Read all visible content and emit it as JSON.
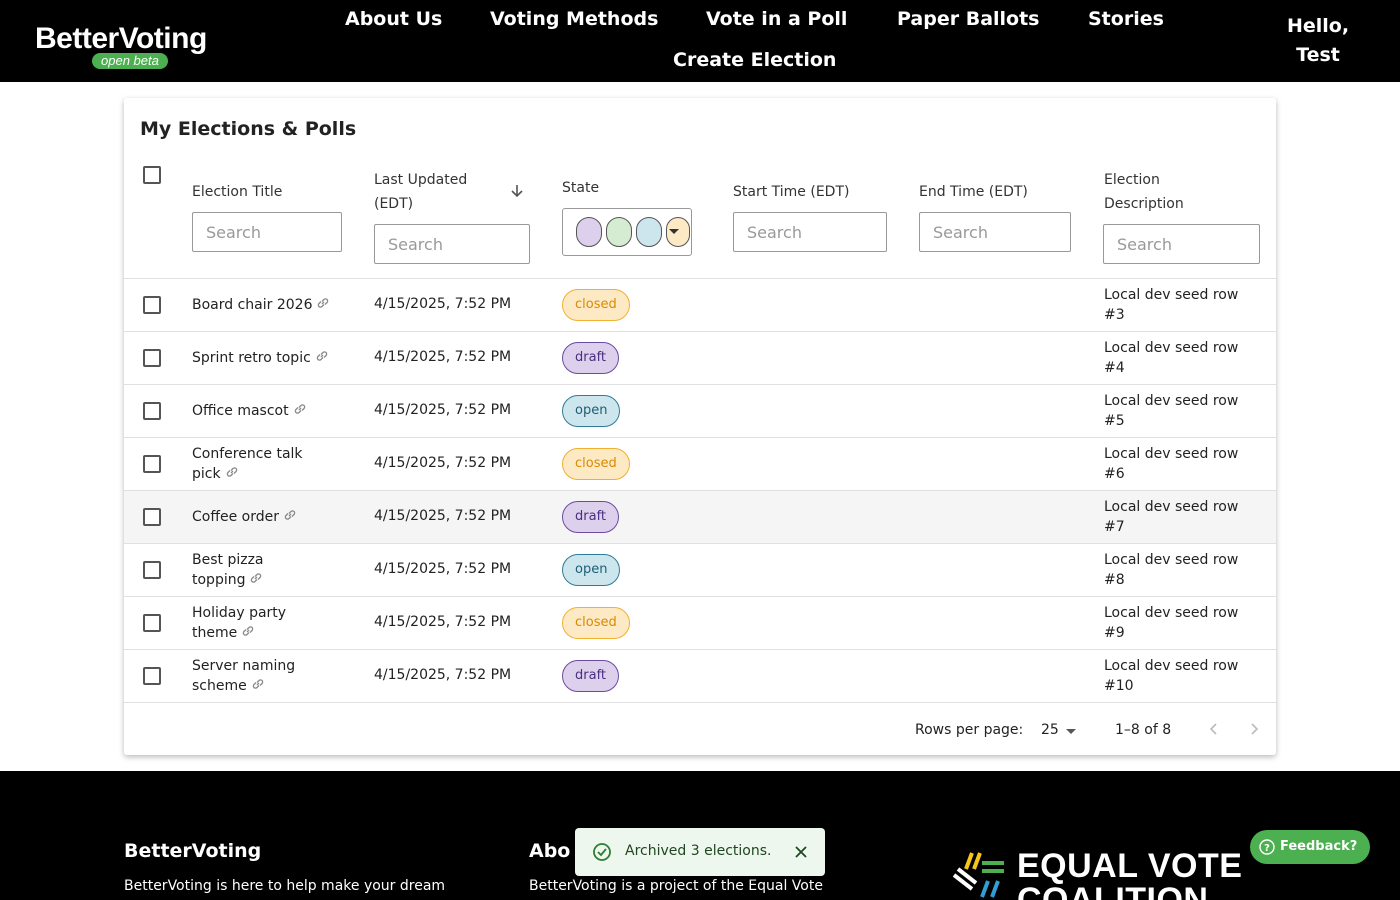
{
  "header": {
    "logo_text": "BetterVoting",
    "beta_label": "open beta",
    "nav": [
      "About Us",
      "Voting Methods",
      "Vote in a Poll",
      "Paper Ballots",
      "Stories",
      "Create Election"
    ],
    "greeting_line1": "Hello,",
    "greeting_line2": "Test"
  },
  "main": {
    "title": "My Elections & Polls",
    "columns": {
      "title": "Election Title",
      "updated_line1": "Last Updated",
      "updated_line2": "(EDT)",
      "state": "State",
      "start": "Start Time (EDT)",
      "end": "End Time (EDT)",
      "desc_line1": "Election",
      "desc_line2": "Description"
    },
    "search_placeholder": "Search",
    "state_filter_colors": [
      "#ddd0ec",
      "#d6ecd2",
      "#cde6ee",
      "#fde9c4"
    ],
    "rows": [
      {
        "title_line1": "Board chair 2026",
        "title_line2": "",
        "updated": "4/15/2025, 7:52 PM",
        "state": "closed",
        "desc_line1": "Local dev seed row",
        "desc_line2": "#3"
      },
      {
        "title_line1": "Sprint retro topic",
        "title_line2": "",
        "updated": "4/15/2025, 7:52 PM",
        "state": "draft",
        "desc_line1": "Local dev seed row",
        "desc_line2": "#4"
      },
      {
        "title_line1": "Office mascot",
        "title_line2": "",
        "updated": "4/15/2025, 7:52 PM",
        "state": "open",
        "desc_line1": "Local dev seed row",
        "desc_line2": "#5"
      },
      {
        "title_line1": "Conference talk",
        "title_line2": "pick",
        "updated": "4/15/2025, 7:52 PM",
        "state": "closed",
        "desc_line1": "Local dev seed row",
        "desc_line2": "#6"
      },
      {
        "title_line1": "Coffee order",
        "title_line2": "",
        "updated": "4/15/2025, 7:52 PM",
        "state": "draft",
        "desc_line1": "Local dev seed row",
        "desc_line2": "#7"
      },
      {
        "title_line1": "Best pizza",
        "title_line2": "topping",
        "updated": "4/15/2025, 7:52 PM",
        "state": "open",
        "desc_line1": "Local dev seed row",
        "desc_line2": "#8"
      },
      {
        "title_line1": "Holiday party",
        "title_line2": "theme",
        "updated": "4/15/2025, 7:52 PM",
        "state": "closed",
        "desc_line1": "Local dev seed row",
        "desc_line2": "#9"
      },
      {
        "title_line1": "Server naming",
        "title_line2": "scheme",
        "updated": "4/15/2025, 7:52 PM",
        "state": "draft",
        "desc_line1": "Local dev seed row",
        "desc_line2": "#10"
      }
    ],
    "pagination": {
      "rows_per_page_label": "Rows per page:",
      "rows_per_page": "25",
      "range": "1–8 of 8"
    }
  },
  "footer": {
    "col1_title": "BetterVoting",
    "col1_text": "BetterVoting is here to help make your dream",
    "col2_title": "Abo",
    "col2_text": "BetterVoting is a project of the Equal Vote",
    "partner_line1": "EQUAL VOTE",
    "partner_line2": "COALITION"
  },
  "toast": {
    "message": "Archived 3 elections."
  },
  "feedback": {
    "label": "Feedback?"
  }
}
